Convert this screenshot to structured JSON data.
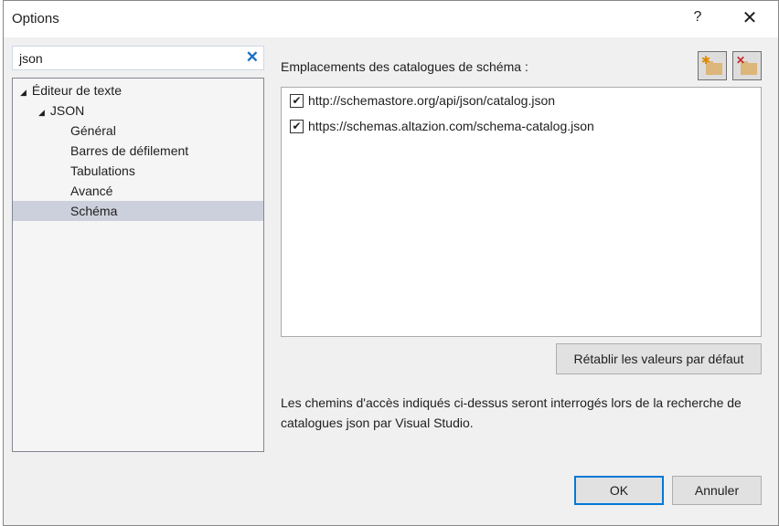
{
  "window": {
    "title": "Options",
    "help": "?",
    "close": "✕"
  },
  "search": {
    "value": "json",
    "clear": "✕"
  },
  "tree": [
    {
      "label": "Éditeur de texte"
    },
    {
      "label": "JSON"
    },
    {
      "label": "Général"
    },
    {
      "label": "Barres de défilement"
    },
    {
      "label": "Tabulations"
    },
    {
      "label": "Avancé"
    },
    {
      "label": "Schéma"
    }
  ],
  "main": {
    "label": "Emplacements des catalogues de schéma :",
    "items": [
      {
        "text": "http://schemastore.org/api/json/catalog.json",
        "checked": true
      },
      {
        "text": "https://schemas.altazion.com/schema-catalog.json",
        "checked": true
      }
    ],
    "reset": "Rétablir les valeurs par défaut",
    "description": "Les chemins d'accès indiqués ci-dessus seront interrogés lors de la recherche de catalogues json par Visual Studio."
  },
  "buttons": {
    "ok": "OK",
    "cancel": "Annuler"
  }
}
